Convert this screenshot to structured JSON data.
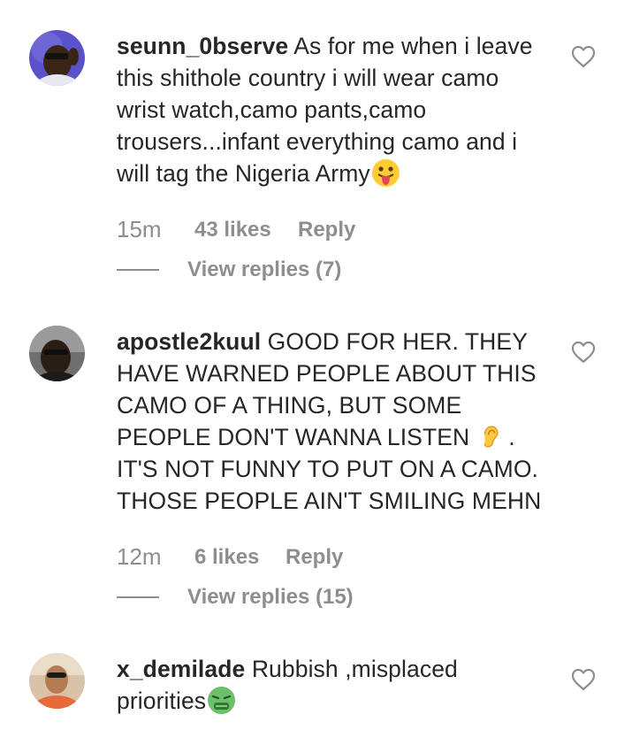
{
  "comments": [
    {
      "username": "seunn_0bserve",
      "text": " As for me when i leave this shithole country i will wear camo wrist watch,camo pants,camo trousers...infant everything camo and i will tag the Nigeria Army",
      "emoji": "tongue-out-emoji",
      "time": "15m",
      "likes": "43 likes",
      "reply": "Reply",
      "view_replies": "View replies (7)"
    },
    {
      "username": "apostle2kuul",
      "text": " GOOD FOR HER. THEY HAVE WARNED PEOPLE ABOUT THIS CAMO OF A THING, BUT SOME PEOPLE DON'T WANNA LISTEN ",
      "emoji": "ear-emoji",
      "text_after": " . IT'S NOT FUNNY TO PUT ON A CAMO. THOSE PEOPLE AIN'T SMILING MEHN",
      "time": "12m",
      "likes": "6 likes",
      "reply": "Reply",
      "view_replies": "View replies (15)"
    },
    {
      "username": "x_demilade",
      "text": " Rubbish ,misplaced priorities",
      "emoji": "nauseated-face-emoji"
    }
  ],
  "icons": {
    "like": "heart-outline-icon"
  },
  "colors": {
    "text": "#262626",
    "secondary": "#8e8e8e",
    "background": "#ffffff"
  }
}
